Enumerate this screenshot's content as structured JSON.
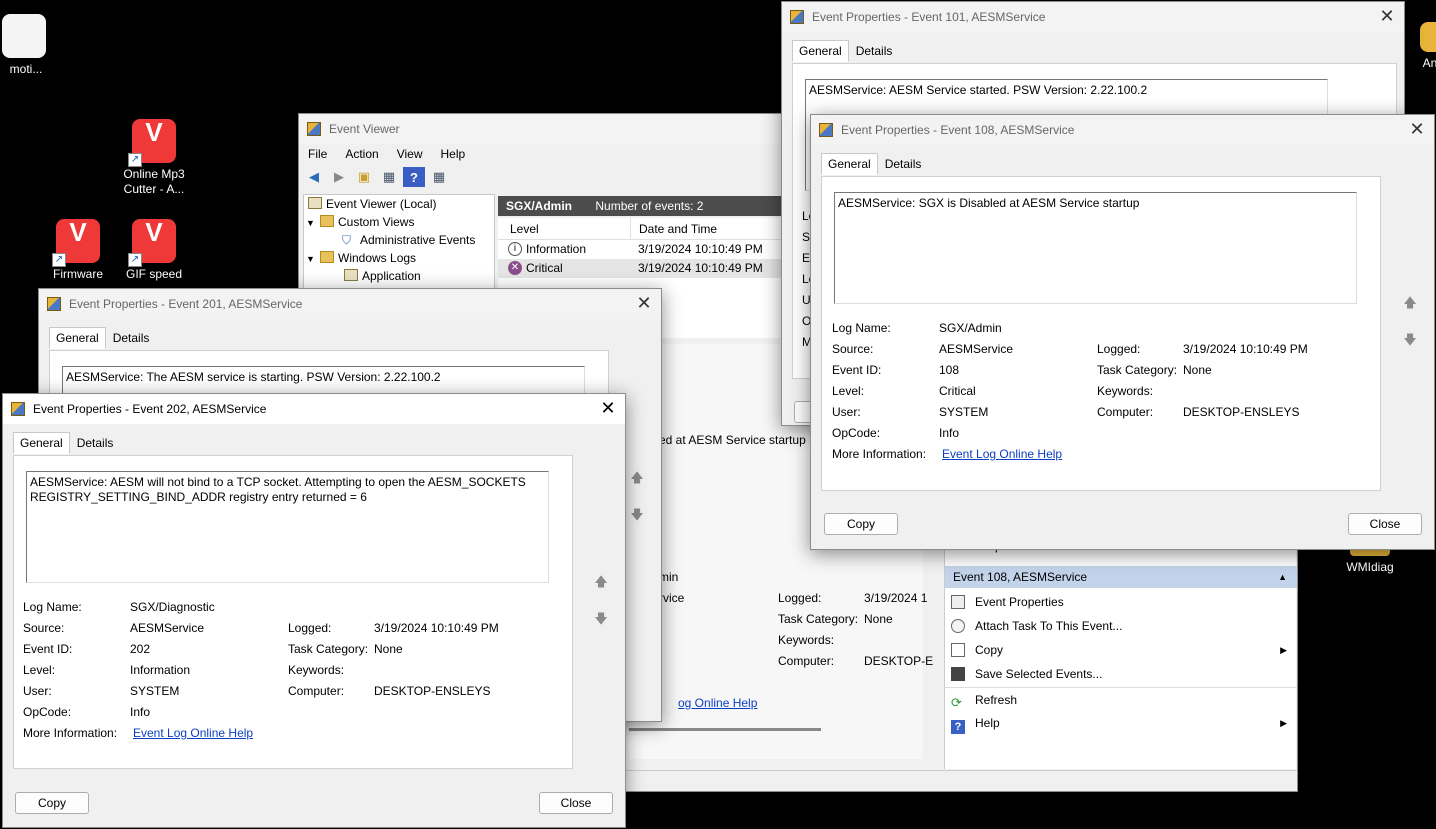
{
  "desktop": {
    "icons": [
      {
        "label": "moti...",
        "kind": "java"
      },
      {
        "label": "Online Mp3 Cutter - A...",
        "kind": "vivaldi"
      },
      {
        "label": "Firmware",
        "kind": "vivaldi"
      },
      {
        "label": "GIF speed",
        "kind": "vivaldi"
      },
      {
        "label": "An",
        "kind": "folder"
      },
      {
        "label": "WMIdiag",
        "kind": "folder"
      }
    ]
  },
  "event_viewer": {
    "title": "Event Viewer",
    "menu": [
      "File",
      "Action",
      "View",
      "Help"
    ],
    "tree": {
      "root": "Event Viewer (Local)",
      "custom_views": "Custom Views",
      "admin_events": "Administrative Events",
      "windows_logs": "Windows Logs",
      "application": "Application"
    },
    "list_header": {
      "log": "SGX/Admin",
      "count": "Number of events: 2"
    },
    "columns": [
      "Level",
      "Date and Time"
    ],
    "rows": [
      {
        "level": "Information",
        "date": "3/19/2024 10:10:49 PM"
      },
      {
        "level": "Critical",
        "date": "3/19/2024 10:10:49 PM"
      }
    ],
    "preview": {
      "desc_fragment": "ed at AESM Service startup",
      "source_fragment": "min",
      "source2_fragment": "rvice",
      "logged_label": "Logged:",
      "logged_value": "3/19/2024 1",
      "task_label": "Task Category:",
      "task_value": "None",
      "keywords_label": "Keywords:",
      "computer_label": "Computer:",
      "computer_value": "DESKTOP-E",
      "link_fragment": "og Online Help"
    },
    "actions": {
      "help_top": "Help",
      "section": "Event 108, AESMService",
      "items": [
        "Event Properties",
        "Attach Task To This Event...",
        "Copy",
        "Save Selected Events...",
        "Refresh",
        "Help"
      ]
    }
  },
  "win101": {
    "title": "Event Properties - Event 101, AESMService",
    "tabs": [
      "General",
      "Details"
    ],
    "description": "AESMService: AESM Service started. PSW Version: 2.22.100.2",
    "left_fragments": [
      "Lo",
      "So",
      "Ev",
      "Le",
      "U",
      "O",
      "M"
    ]
  },
  "win108": {
    "title": "Event Properties - Event 108, AESMService",
    "tabs": [
      "General",
      "Details"
    ],
    "description": "AESMService: SGX is Disabled at AESM Service startup",
    "fields": {
      "log_name_label": "Log Name:",
      "log_name": "SGX/Admin",
      "source_label": "Source:",
      "source": "AESMService",
      "logged_label": "Logged:",
      "logged": "3/19/2024 10:10:49 PM",
      "event_id_label": "Event ID:",
      "event_id": "108",
      "task_label": "Task Category:",
      "task": "None",
      "level_label": "Level:",
      "level": "Critical",
      "keywords_label": "Keywords:",
      "user_label": "User:",
      "user": "SYSTEM",
      "computer_label": "Computer:",
      "computer": "DESKTOP-ENSLEYS",
      "opcode_label": "OpCode:",
      "opcode": "Info",
      "more_info_label": "More Information:",
      "more_info_link": "Event Log Online Help"
    },
    "copy": "Copy",
    "close": "Close"
  },
  "win201": {
    "title": "Event Properties - Event 201, AESMService",
    "tabs": [
      "General",
      "Details"
    ],
    "description": "AESMService: The AESM service is starting. PSW Version: 2.22.100.2"
  },
  "win202": {
    "title": "Event Properties - Event 202, AESMService",
    "tabs": [
      "General",
      "Details"
    ],
    "description": "AESMService: AESM will not bind to a TCP socket. Attempting to open the AESM_SOCKETS REGISTRY_SETTING_BIND_ADDR registry entry returned = 6",
    "fields": {
      "log_name_label": "Log Name:",
      "log_name": "SGX/Diagnostic",
      "source_label": "Source:",
      "source": "AESMService",
      "logged_label": "Logged:",
      "logged": "3/19/2024 10:10:49 PM",
      "event_id_label": "Event ID:",
      "event_id": "202",
      "task_label": "Task Category:",
      "task": "None",
      "level_label": "Level:",
      "level": "Information",
      "keywords_label": "Keywords:",
      "user_label": "User:",
      "user": "SYSTEM",
      "computer_label": "Computer:",
      "computer": "DESKTOP-ENSLEYS",
      "opcode_label": "OpCode:",
      "opcode": "Info",
      "more_info_label": "More Information:",
      "more_info_link": "Event Log Online Help"
    },
    "copy": "Copy",
    "close": "Close"
  }
}
